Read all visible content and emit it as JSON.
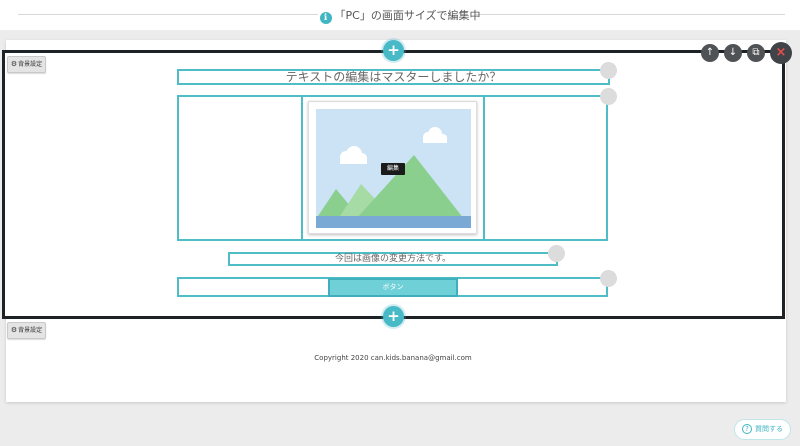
{
  "header": {
    "info_icon": "ℹ",
    "title": "「PC」の画面サイズで編集中"
  },
  "section_toolbar": {
    "up_icon": "↑",
    "down_icon": "↓",
    "copy_icon": "⧉",
    "close_icon": "×"
  },
  "add_icon": "+",
  "bg_settings_label": "背景設定",
  "bg_settings_icon": "⚙",
  "content": {
    "heading": "テキストの編集はマスターしましたか？",
    "image_edit_label": "編集",
    "subtext": "今回は画像の変更方法です。",
    "button_label": "ボタン"
  },
  "footer": {
    "copyright": "Copyright 2020 can.kids.banana@gmail.com"
  },
  "help": {
    "icon": "?",
    "label": "質問する"
  },
  "colors": {
    "accent": "#48b9c6",
    "frame": "#4fbdc6",
    "button_fill": "#6fd0d8",
    "section_border": "#1d2227",
    "sky": "#cbe3f5",
    "hills": "#8bcf8f",
    "water": "#7aa9d6"
  }
}
